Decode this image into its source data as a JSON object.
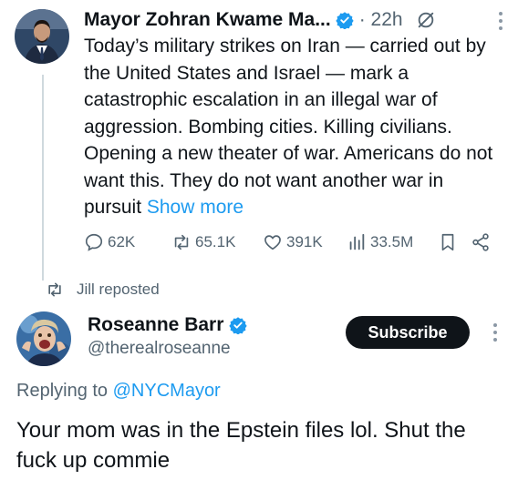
{
  "colors": {
    "accent": "#1d9bf0",
    "text": "#0f1419",
    "muted": "#536471",
    "thread_line": "#cfd9de"
  },
  "tweet1": {
    "author_name": "Mayor Zohran Kwame Ma...",
    "time": "· 22h",
    "text": "Today’s military strikes on Iran — carried out by the United States and Israel — mark a catastrophic escalation in an illegal war of aggression. Bombing cities. Killing civilians. Opening a new theater of war.  Americans do not want this. They do not want another war in pursuit ",
    "show_more": "Show more",
    "actions": {
      "replies": "62K",
      "reposts": "65.1K",
      "likes": "391K",
      "views": "33.5M"
    },
    "icons": [
      "verified-icon",
      "grok-icon",
      "more-icon",
      "reply-icon",
      "repost-icon",
      "like-icon",
      "views-icon",
      "bookmark-icon",
      "share-icon"
    ]
  },
  "repost_notice": "Jill reposted",
  "tweet2": {
    "author_name": "Roseanne Barr",
    "handle": "@therealroseanne",
    "subscribe_label": "Subscribe",
    "replying_prefix": "Replying to ",
    "replying_to": "@NYCMayor",
    "text": "Your mom was in the Epstein files lol. Shut the fuck up commie"
  }
}
